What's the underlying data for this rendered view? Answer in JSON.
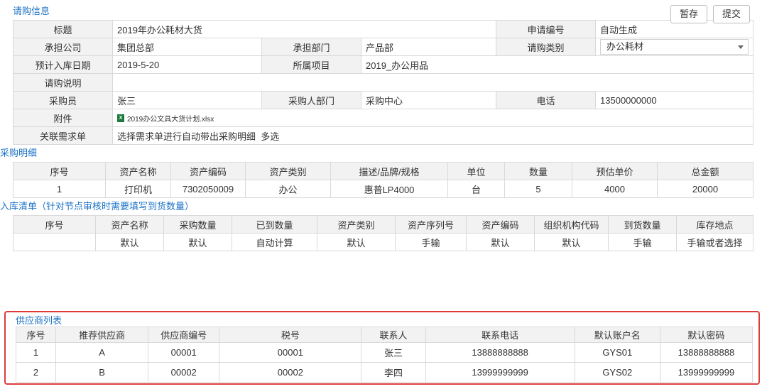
{
  "toolbar": {
    "save_draft": "暂存",
    "submit": "提交"
  },
  "request_info": {
    "title": "请购信息",
    "rows": {
      "title_label": "标题",
      "title_value": "2019年办公耗材大货",
      "req_no_label": "申请编号",
      "req_no_value": "自动生成",
      "company_label": "承担公司",
      "company_value": "集团总部",
      "dept_label": "承担部门",
      "dept_value": "产品部",
      "type_label": "请购类别",
      "type_value": "办公耗材",
      "date_label": "预计入库日期",
      "date_value": "2019-5-20",
      "project_label": "所属项目",
      "project_value": "2019_办公用品",
      "desc_label": "请购说明",
      "desc_value": "",
      "buyer_label": "采购员",
      "buyer_value": "张三",
      "buyer_dept_label": "采购人部门",
      "buyer_dept_value": "采购中心",
      "phone_label": "电话",
      "phone_value": "13500000000",
      "attach_label": "附件",
      "attach_value": "2019办公文具大货计划.xlsx",
      "demand_label": "关联需求单",
      "demand_value": "选择需求单进行自动带出采购明细",
      "demand_multi": "多选"
    }
  },
  "purchase_detail": {
    "title": "采购明细",
    "columns": [
      "序号",
      "资产名称",
      "资产编码",
      "资产类别",
      "描述/品牌/规格",
      "单位",
      "数量",
      "预估单价",
      "总金额"
    ],
    "rows": [
      [
        "1",
        "打印机",
        "7302050009",
        "办公",
        "惠普LP4000",
        "台",
        "5",
        "4000",
        "20000"
      ]
    ]
  },
  "inbound_list": {
    "title": "入库清单（针对节点审核时需要填写到货数量）",
    "columns": [
      "序号",
      "资产名称",
      "采购数量",
      "已到数量",
      "资产类别",
      "资产序列号",
      "资产编码",
      "组织机构代码",
      "到货数量",
      "库存地点"
    ],
    "rows": [
      [
        "",
        "默认",
        "默认",
        "自动计算",
        "默认",
        "手输",
        "默认",
        "默认",
        "手输",
        "手输或者选择"
      ]
    ]
  },
  "supplier_list": {
    "title": "供应商列表",
    "columns": [
      "序号",
      "推荐供应商",
      "供应商编号",
      "税号",
      "联系人",
      "联系电话",
      "默认账户名",
      "默认密码"
    ],
    "rows": [
      [
        "1",
        "A",
        "00001",
        "00001",
        "张三",
        "13888888888",
        "GYS01",
        "13888888888"
      ],
      [
        "2",
        "B",
        "00002",
        "00002",
        "李四",
        "13999999999",
        "GYS02",
        "13999999999"
      ]
    ]
  },
  "colors": {
    "section_title": "#1e73c6",
    "highlight_border": "#e03b3b",
    "label_bg": "#f2f2f2"
  }
}
